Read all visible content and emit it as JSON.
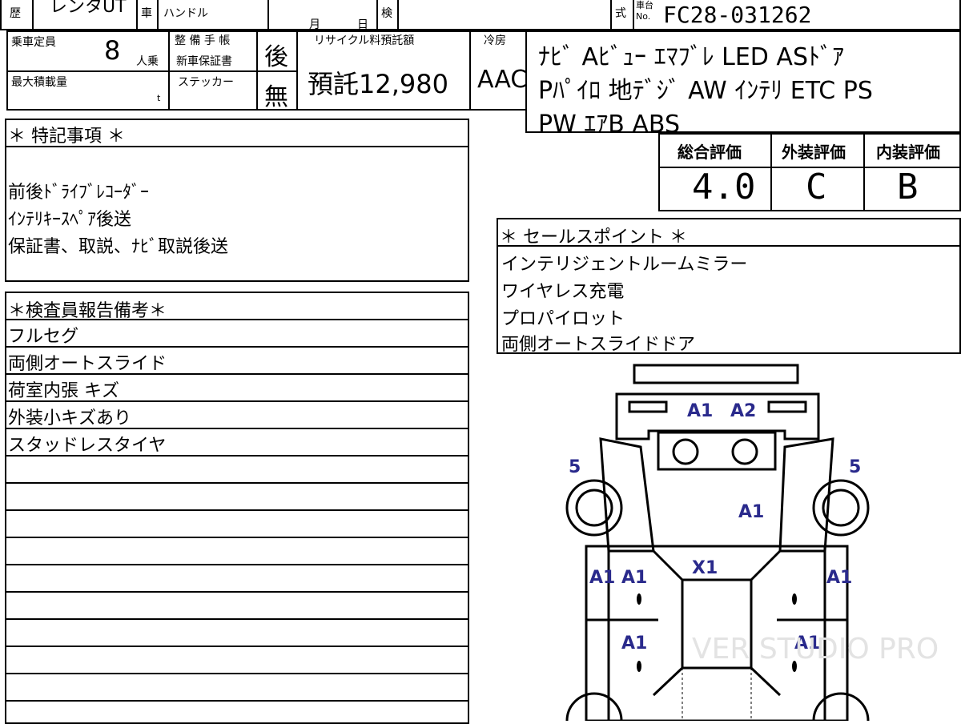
{
  "top": {
    "history_label": "歴",
    "model_fragment": "レンタUT",
    "car_label": "車",
    "handle_label": "ハンドル",
    "month_label": "月",
    "day_label": "日",
    "inspect_label": "検",
    "type_label": "式",
    "chassis_label": "車台",
    "chassis_no_label": "No.",
    "chassis_no": "FC28-031262"
  },
  "specs": {
    "capacity_label": "乗車定員",
    "capacity_value": "8",
    "capacity_unit": "人乗",
    "max_load_label": "最大積載量",
    "max_load_unit": "t",
    "service_label": "整 備 手 帳",
    "warranty_label": "新車保証書",
    "sticker_label": "ステッカー",
    "service_value": "後",
    "sticker_value": "無",
    "recycle_label": "リサイクル料預託額",
    "recycle_value": "預託12,980",
    "ac_label": "冷房",
    "ac_value": "AAC",
    "equipment": [
      "ﾅﾋﾞ Aﾋﾞｭｰ ｴﾏﾌﾞﾚ LED ASﾄﾞｱ",
      "Pﾊﾟｲﾛ 地ﾃﾞｼﾞ AW ｲﾝﾃﾘ ETC PS",
      "PW ｴｱB ABS"
    ]
  },
  "ratings": {
    "overall_label": "総合評価",
    "exterior_label": "外装評価",
    "interior_label": "内装評価",
    "overall_value": "4.0",
    "exterior_value": "C",
    "interior_value": "B"
  },
  "special_notes": {
    "title": "＊ 特記事項 ＊",
    "lines": [
      "前後ﾄﾞﾗｲﾌﾞﾚｺｰﾀﾞｰ",
      "ｲﾝﾃﾘｷｰｽﾍﾟｱ後送",
      "保証書、取説、ﾅﾋﾞ取説後送"
    ]
  },
  "sales_points": {
    "title": "＊ セールスポイント ＊",
    "lines": [
      "インテリジェントルームミラー",
      "ワイヤレス充電",
      "プロパイロット",
      "両側オートスライドドア"
    ]
  },
  "inspector": {
    "title": "＊検査員報告備考＊",
    "lines": [
      "フルセグ",
      "両側オートスライド",
      "荷室内張 キズ",
      "外装小キズあり",
      "スタッドレスタイヤ"
    ]
  },
  "diagram": {
    "marks": [
      "A1",
      "A2",
      "5",
      "5",
      "A1",
      "X1",
      "A1",
      "A1",
      "A1",
      "A1",
      "A1"
    ],
    "watermark": "VER STUDIO PRO"
  }
}
